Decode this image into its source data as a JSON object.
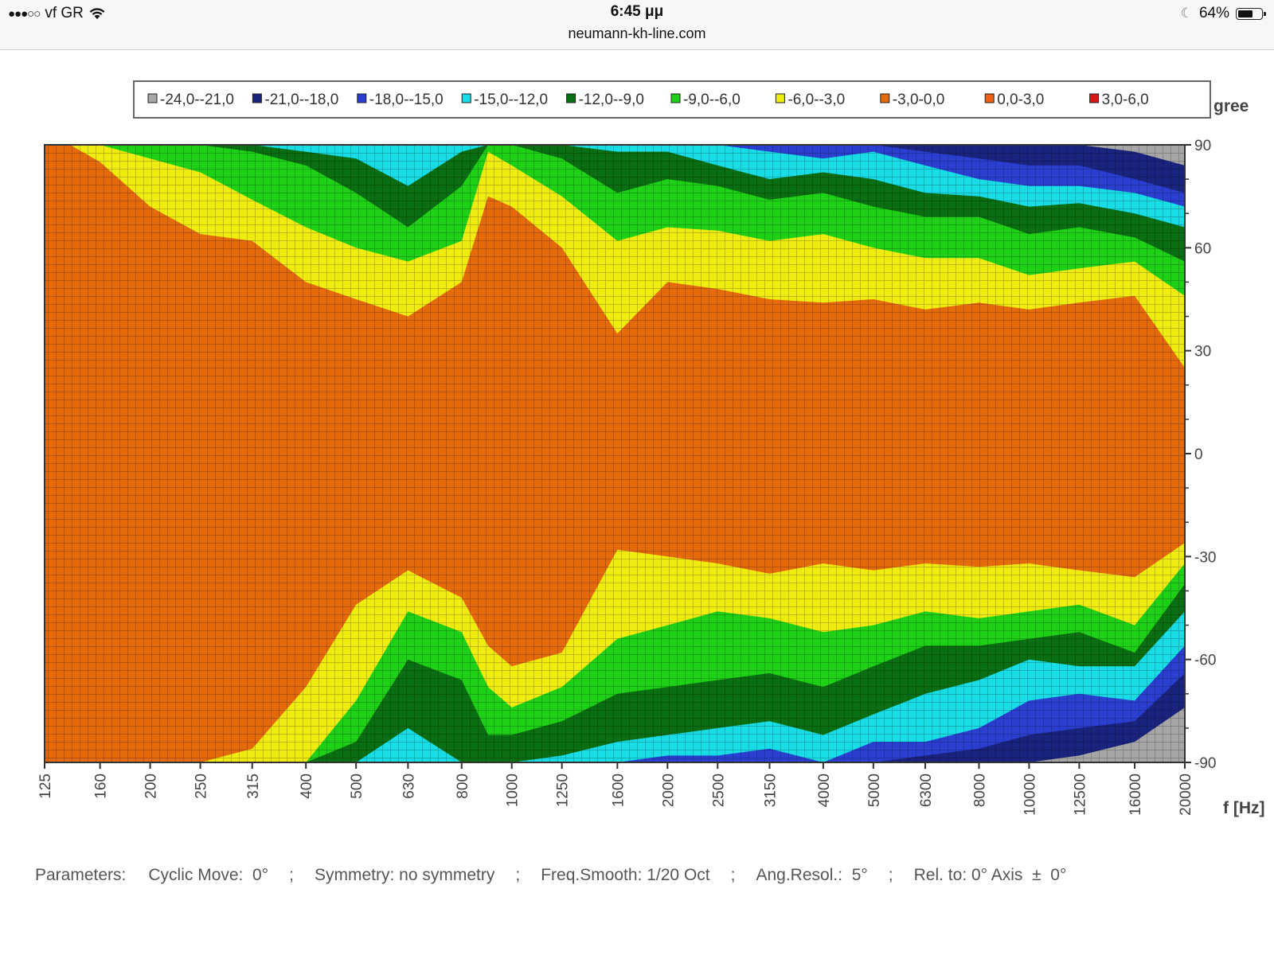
{
  "status_bar": {
    "carrier": "vf GR",
    "time": "6:45 μμ",
    "url": "neumann-kh-line.com",
    "battery_text": "64%",
    "battery_level": 0.64
  },
  "chart_data": {
    "type": "heatmap",
    "title": "",
    "xlabel": "f [Hz]",
    "ylabel": "gree",
    "x_ticks": [
      "125",
      "160",
      "200",
      "250",
      "315",
      "400",
      "500",
      "630",
      "800",
      "1000",
      "1250",
      "1600",
      "2000",
      "2500",
      "3150",
      "4000",
      "5000",
      "6300",
      "8000",
      "10000",
      "12500",
      "16000",
      "20000"
    ],
    "x_range": [
      125,
      20000
    ],
    "x_scale": "log",
    "y_ticks": [
      "90",
      "60",
      "30",
      "0",
      "-30",
      "-60",
      "-90"
    ],
    "y_range": [
      -90,
      90
    ],
    "grid": true,
    "legend_position": "top",
    "legend": [
      {
        "label": "-24,0--21,0",
        "color": "#a6a6a6"
      },
      {
        "label": "-21,0--18,0",
        "color": "#1a237e"
      },
      {
        "label": "-18,0--15,0",
        "color": "#2a3fd0"
      },
      {
        "label": "-15,0--12,0",
        "color": "#18dde6"
      },
      {
        "label": "-12,0--9,0",
        "color": "#0a6e12"
      },
      {
        "label": "-9,0--6,0",
        "color": "#1ed016"
      },
      {
        "label": "-6,0--3,0",
        "color": "#f0ec10"
      },
      {
        "label": "-3,0-0,0",
        "color": "#e56a0a"
      },
      {
        "label": "0,0-3,0",
        "color": "#ec6010"
      },
      {
        "label": "3,0-6,0",
        "color": "#d81616"
      }
    ],
    "contours_upper": {
      "x": [
        125,
        140,
        160,
        200,
        250,
        315,
        400,
        500,
        630,
        800,
        900,
        1000,
        1250,
        1600,
        2000,
        2500,
        3150,
        4000,
        5000,
        6300,
        8000,
        10000,
        12500,
        16000,
        20000
      ],
      "boundary_-3": [
        90,
        90,
        85,
        72,
        64,
        62,
        50,
        45,
        40,
        50,
        75,
        72,
        60,
        35,
        50,
        48,
        45,
        44,
        45,
        42,
        44,
        42,
        44,
        46,
        25
      ],
      "boundary_-6": [
        90,
        90,
        90,
        86,
        82,
        74,
        66,
        60,
        56,
        62,
        88,
        84,
        75,
        62,
        66,
        65,
        62,
        64,
        60,
        57,
        57,
        52,
        54,
        56,
        46
      ],
      "boundary_-9": [
        90,
        90,
        90,
        90,
        90,
        88,
        84,
        76,
        66,
        78,
        90,
        90,
        86,
        76,
        80,
        78,
        74,
        76,
        72,
        69,
        69,
        64,
        66,
        63,
        56
      ],
      "boundary_-12": [
        90,
        90,
        90,
        90,
        90,
        90,
        88,
        86,
        78,
        88,
        90,
        90,
        90,
        88,
        88,
        84,
        80,
        82,
        80,
        76,
        75,
        72,
        73,
        70,
        66
      ],
      "boundary_-15": [
        90,
        90,
        90,
        90,
        90,
        90,
        90,
        90,
        90,
        90,
        90,
        90,
        90,
        90,
        90,
        90,
        88,
        86,
        88,
        84,
        80,
        78,
        78,
        76,
        72
      ],
      "boundary_-18": [
        90,
        90,
        90,
        90,
        90,
        90,
        90,
        90,
        90,
        90,
        90,
        90,
        90,
        90,
        90,
        90,
        90,
        90,
        90,
        88,
        86,
        84,
        84,
        80,
        76
      ],
      "boundary_-21": [
        90,
        90,
        90,
        90,
        90,
        90,
        90,
        90,
        90,
        90,
        90,
        90,
        90,
        90,
        90,
        90,
        90,
        90,
        90,
        90,
        90,
        90,
        90,
        88,
        84
      ]
    },
    "contours_lower": {
      "x": [
        125,
        140,
        160,
        200,
        250,
        315,
        400,
        500,
        630,
        800,
        900,
        1000,
        1250,
        1600,
        2000,
        2500,
        3150,
        4000,
        5000,
        6300,
        8000,
        10000,
        12500,
        16000,
        20000
      ],
      "boundary_-3": [
        -90,
        -90,
        -90,
        -90,
        -90,
        -86,
        -68,
        -44,
        -34,
        -42,
        -56,
        -62,
        -58,
        -28,
        -30,
        -32,
        -35,
        -32,
        -34,
        -32,
        -33,
        -32,
        -34,
        -36,
        -26
      ],
      "boundary_-6": [
        -90,
        -90,
        -90,
        -90,
        -90,
        -90,
        -90,
        -72,
        -46,
        -52,
        -68,
        -74,
        -68,
        -54,
        -50,
        -46,
        -48,
        -52,
        -50,
        -46,
        -48,
        -46,
        -44,
        -50,
        -32
      ],
      "boundary_-9": [
        -90,
        -90,
        -90,
        -90,
        -90,
        -90,
        -90,
        -84,
        -60,
        -66,
        -82,
        -82,
        -78,
        -70,
        -68,
        -66,
        -64,
        -68,
        -62,
        -56,
        -56,
        -54,
        -52,
        -58,
        -38
      ],
      "boundary_-12": [
        -90,
        -90,
        -90,
        -90,
        -90,
        -90,
        -90,
        -90,
        -80,
        -90,
        -90,
        -90,
        -88,
        -84,
        -82,
        -80,
        -78,
        -82,
        -76,
        -70,
        -66,
        -60,
        -62,
        -62,
        -46
      ],
      "boundary_-15": [
        -90,
        -90,
        -90,
        -90,
        -90,
        -90,
        -90,
        -90,
        -90,
        -90,
        -90,
        -90,
        -90,
        -90,
        -88,
        -88,
        -86,
        -90,
        -84,
        -84,
        -80,
        -72,
        -70,
        -72,
        -56
      ],
      "boundary_-18": [
        -90,
        -90,
        -90,
        -90,
        -90,
        -90,
        -90,
        -90,
        -90,
        -90,
        -90,
        -90,
        -90,
        -90,
        -90,
        -90,
        -90,
        -90,
        -90,
        -88,
        -86,
        -82,
        -80,
        -78,
        -64
      ],
      "boundary_-21": [
        -90,
        -90,
        -90,
        -90,
        -90,
        -90,
        -90,
        -90,
        -90,
        -90,
        -90,
        -90,
        -90,
        -90,
        -90,
        -90,
        -90,
        -90,
        -90,
        -90,
        -90,
        -90,
        -88,
        -84,
        -74
      ]
    }
  },
  "parameters": {
    "label": "Parameters:",
    "cyclic_move": "Cyclic Move:  0°",
    "symmetry": "Symmetry: no symmetry",
    "freq_smooth": "Freq.Smooth: 1/20 Oct",
    "ang_resol": "Ang.Resol.:  5°",
    "rel_to": "Rel. to: 0° Axis  ±  0°",
    "separator": ";"
  },
  "icons": {
    "signal": "signal-dots-icon",
    "wifi": "wifi-icon",
    "moon": "moon-icon",
    "battery": "battery-icon"
  }
}
